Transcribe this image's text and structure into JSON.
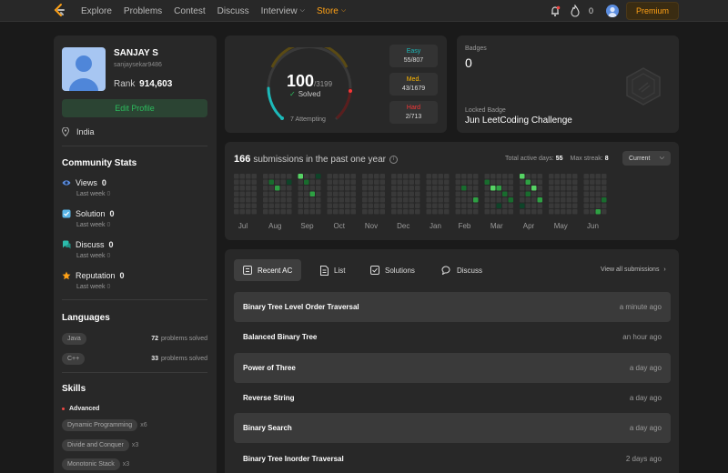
{
  "nav": {
    "items": [
      {
        "label": "Explore",
        "dropdown": false,
        "active": false
      },
      {
        "label": "Problems",
        "dropdown": false,
        "active": false
      },
      {
        "label": "Contest",
        "dropdown": false,
        "active": false
      },
      {
        "label": "Discuss",
        "dropdown": false,
        "active": false
      },
      {
        "label": "Interview",
        "dropdown": true,
        "active": false
      },
      {
        "label": "Store",
        "dropdown": true,
        "active": true
      }
    ],
    "streak": "0",
    "premium_label": "Premium",
    "accent": "#ffa116"
  },
  "profile": {
    "name": "SANJAY S",
    "handle": "sanjaysekar9486",
    "rank_label": "Rank",
    "rank": "914,603",
    "edit_label": "Edit Profile",
    "location": "India"
  },
  "community": {
    "title": "Community Stats",
    "stats": [
      {
        "label": "Views",
        "value": "0",
        "last_week_label": "Last week",
        "last_week": "0",
        "icon": "eye-icon",
        "color": "#5b8de0"
      },
      {
        "label": "Solution",
        "value": "0",
        "last_week_label": "Last week",
        "last_week": "0",
        "icon": "check-square-icon",
        "color": "#5ab6e8"
      },
      {
        "label": "Discuss",
        "value": "0",
        "last_week_label": "Last week",
        "last_week": "0",
        "icon": "chat-icon",
        "color": "#2cbbab"
      },
      {
        "label": "Reputation",
        "value": "0",
        "last_week_label": "Last week",
        "last_week": "0",
        "icon": "star-icon",
        "color": "#ffa116"
      }
    ]
  },
  "languages": {
    "title": "Languages",
    "items": [
      {
        "name": "Java",
        "count": "72",
        "suffix": "problems solved"
      },
      {
        "name": "C++",
        "count": "33",
        "suffix": "problems solved"
      }
    ]
  },
  "skills": {
    "title": "Skills",
    "level": "Advanced",
    "items": [
      {
        "name": "Dynamic Programming",
        "count": "x6"
      },
      {
        "name": "Divide and Conquer",
        "count": "x3"
      },
      {
        "name": "Monotonic Stack",
        "count": "x3"
      }
    ]
  },
  "solved": {
    "count": "100",
    "total": "/3199",
    "label": "Solved",
    "attempting": "7 Attempting",
    "solved_fraction": 0.031,
    "difficulty": [
      {
        "label": "Easy",
        "value": "55/807",
        "color": "#1cbaba"
      },
      {
        "label": "Med.",
        "value": "43/1679",
        "color": "#ffb700"
      },
      {
        "label": "Hard",
        "value": "2/713",
        "color": "#f63737"
      }
    ]
  },
  "badges": {
    "title": "Badges",
    "count": "0",
    "locked_label": "Locked Badge",
    "locked_name": "Jun LeetCoding Challenge"
  },
  "submissions": {
    "count": "166",
    "text": "submissions in the past one year",
    "active_days_label": "Total active days:",
    "active_days": "55",
    "max_streak_label": "Max streak:",
    "max_streak": "8",
    "selector": "Current",
    "months": [
      "Jul",
      "Aug",
      "Sep",
      "Oct",
      "Nov",
      "Dec",
      "Jan",
      "Feb",
      "Mar",
      "Apr",
      "May",
      "Jun"
    ],
    "colors": {
      "empty": "#393939",
      "level1": "#0e4429",
      "level2": "#196c2e",
      "level3": "#2ea043",
      "level4": "#56d364"
    }
  },
  "recent": {
    "tabs": [
      {
        "label": "Recent AC",
        "icon": "grid-icon",
        "active": true
      },
      {
        "label": "List",
        "icon": "document-icon",
        "active": false
      },
      {
        "label": "Solutions",
        "icon": "check-square-icon",
        "active": false
      },
      {
        "label": "Discuss",
        "icon": "chat-icon",
        "active": false
      }
    ],
    "view_all": "View all submissions",
    "items": [
      {
        "name": "Binary Tree Level Order Traversal",
        "time": "a minute ago"
      },
      {
        "name": "Balanced Binary Tree",
        "time": "an hour ago"
      },
      {
        "name": "Power of Three",
        "time": "a day ago"
      },
      {
        "name": "Reverse String",
        "time": "a day ago"
      },
      {
        "name": "Binary Search",
        "time": "a day ago"
      },
      {
        "name": "Binary Tree Inorder Traversal",
        "time": "2 days ago"
      }
    ]
  }
}
